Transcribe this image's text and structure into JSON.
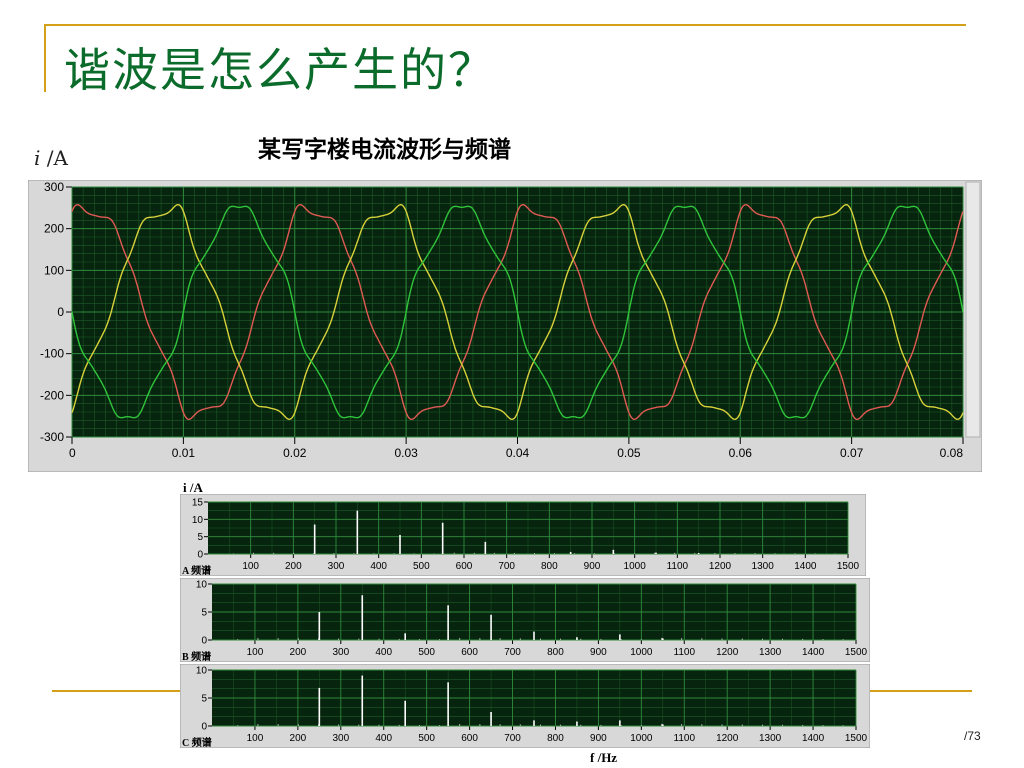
{
  "slide": {
    "title": "谐波是怎么产生的？",
    "subtitle": "某写字楼电流波形与频谱",
    "page_number": "/73"
  },
  "accent_colors": {
    "title": "#0b6b2b",
    "rule": "#d4a017",
    "plot_bg": "#07240f",
    "grid": "#2f8a3a"
  },
  "icons": {
    "ylabel_glyph": "i",
    "ylabel_unit": " /A"
  },
  "chart_data": [
    {
      "type": "line",
      "ylabel": "i /A",
      "x_ticks": [
        "0",
        "0.01",
        "0.02",
        "0.03",
        "0.04",
        "0.05",
        "0.06",
        "0.07",
        "0.08"
      ],
      "y_ticks": [
        "300",
        "200",
        "100",
        "0",
        "-100",
        "-200",
        "-300"
      ],
      "xlim": [
        0,
        0.08
      ],
      "ylim": [
        -300,
        300
      ],
      "grid": true,
      "fundamental_hz": 50,
      "series": [
        {
          "color": "#e05a52",
          "phase_deg": 60,
          "values_desc": "sine, amplitude 250"
        },
        {
          "color": "#d8d23a",
          "phase_deg": -60,
          "values_desc": "sine, amplitude 250"
        },
        {
          "color": "#2fc43a",
          "phase_deg": 180,
          "values_desc": "sine, amplitude 250"
        }
      ],
      "amplitude": 250,
      "harmonic_content": [
        {
          "order": 5,
          "ratio": 0.06
        },
        {
          "order": 7,
          "ratio": 0.04
        },
        {
          "order": 11,
          "ratio": 0.015
        }
      ]
    },
    {
      "type": "bar",
      "label": "A 频谱",
      "ylabel": "i /A",
      "y_ticks": [
        "15",
        "10",
        "5",
        "0"
      ],
      "ylim": [
        0,
        15
      ],
      "x_ticks": [
        "100",
        "200",
        "300",
        "400",
        "500",
        "600",
        "700",
        "800",
        "900",
        "1000",
        "1100",
        "1200",
        "1300",
        "1400",
        "1500"
      ],
      "xlim": [
        0,
        1500
      ],
      "peaks": [
        {
          "f": 250,
          "v": 8.5
        },
        {
          "f": 350,
          "v": 12.5
        },
        {
          "f": 450,
          "v": 5.5
        },
        {
          "f": 550,
          "v": 9
        },
        {
          "f": 650,
          "v": 3.5
        },
        {
          "f": 850,
          "v": 0.6
        },
        {
          "f": 950,
          "v": 1.2
        },
        {
          "f": 1050,
          "v": 0.4
        },
        {
          "f": 1150,
          "v": 0.3
        }
      ]
    },
    {
      "type": "bar",
      "label": "B 频谱",
      "y_ticks": [
        "10",
        "5",
        "0"
      ],
      "ylim": [
        0,
        10
      ],
      "x_ticks": [
        "100",
        "200",
        "300",
        "400",
        "500",
        "600",
        "700",
        "800",
        "900",
        "1000",
        "1100",
        "1200",
        "1300",
        "1400",
        "1500"
      ],
      "xlim": [
        0,
        1500
      ],
      "peaks": [
        {
          "f": 250,
          "v": 5
        },
        {
          "f": 350,
          "v": 8
        },
        {
          "f": 450,
          "v": 1.2
        },
        {
          "f": 550,
          "v": 6.2
        },
        {
          "f": 650,
          "v": 4.5
        },
        {
          "f": 750,
          "v": 1.5
        },
        {
          "f": 850,
          "v": 0.5
        },
        {
          "f": 950,
          "v": 1
        },
        {
          "f": 1050,
          "v": 0.3
        }
      ]
    },
    {
      "type": "bar",
      "label": "C 频谱",
      "xlabel": "f /Hz",
      "y_ticks": [
        "10",
        "5",
        "0"
      ],
      "ylim": [
        0,
        10
      ],
      "x_ticks": [
        "100",
        "200",
        "300",
        "400",
        "500",
        "600",
        "700",
        "800",
        "900",
        "1000",
        "1100",
        "1200",
        "1300",
        "1400",
        "1500"
      ],
      "xlim": [
        0,
        1500
      ],
      "peaks": [
        {
          "f": 250,
          "v": 6.8
        },
        {
          "f": 350,
          "v": 9
        },
        {
          "f": 450,
          "v": 4.5
        },
        {
          "f": 550,
          "v": 7.8
        },
        {
          "f": 650,
          "v": 2.5
        },
        {
          "f": 750,
          "v": 1
        },
        {
          "f": 850,
          "v": 0.8
        },
        {
          "f": 950,
          "v": 1
        },
        {
          "f": 1050,
          "v": 0.3
        }
      ]
    }
  ]
}
